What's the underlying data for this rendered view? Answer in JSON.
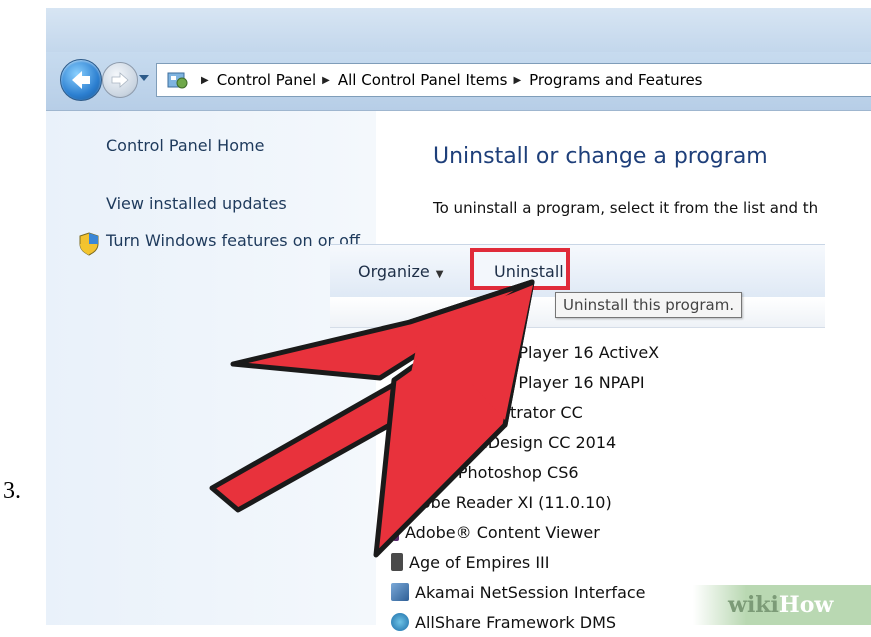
{
  "step_number": "3.",
  "address_bar": {
    "breadcrumbs": [
      "Control Panel",
      "All Control Panel Items",
      "Programs and Features"
    ]
  },
  "sidebar": {
    "items": [
      {
        "label": "Control Panel Home"
      },
      {
        "label": "View installed updates"
      },
      {
        "label": "Turn Windows features on or off",
        "icon": "shield-icon"
      }
    ]
  },
  "main": {
    "title": "Uninstall or change a program",
    "description": "To uninstall a program, select it from the list and th"
  },
  "toolbar": {
    "organize_label": "Organize",
    "uninstall_label": "Uninstall",
    "uninstall_highlight_color": "#e02b3a"
  },
  "tooltip": "Uninstall this program.",
  "programs": [
    {
      "name": "ash Player 16 ActiveX",
      "icon": "flash-icon"
    },
    {
      "name": "ash Player 16 NPAPI",
      "icon": "flash-icon"
    },
    {
      "name": "e Illustrator CC",
      "icon": "illustrator-icon"
    },
    {
      "name": "obe InDesign CC 2014",
      "icon": "indesign-icon"
    },
    {
      "name": "obe Photoshop CS6",
      "icon": "photoshop-icon"
    },
    {
      "name": "Adobe Reader XI (11.0.10)",
      "icon": "adobe-reader-icon"
    },
    {
      "name": "Adobe® Content Viewer",
      "icon": "content-viewer-icon"
    },
    {
      "name": "Age of Empires III",
      "icon": "game-icon"
    },
    {
      "name": "Akamai NetSession Interface",
      "icon": "akamai-icon"
    },
    {
      "name": "AllShare Framework DMS",
      "icon": "allshare-icon"
    }
  ],
  "overlay": {
    "arrow_color": "#e8323c"
  },
  "watermark": {
    "wiki": "wiki",
    "how": "How"
  }
}
